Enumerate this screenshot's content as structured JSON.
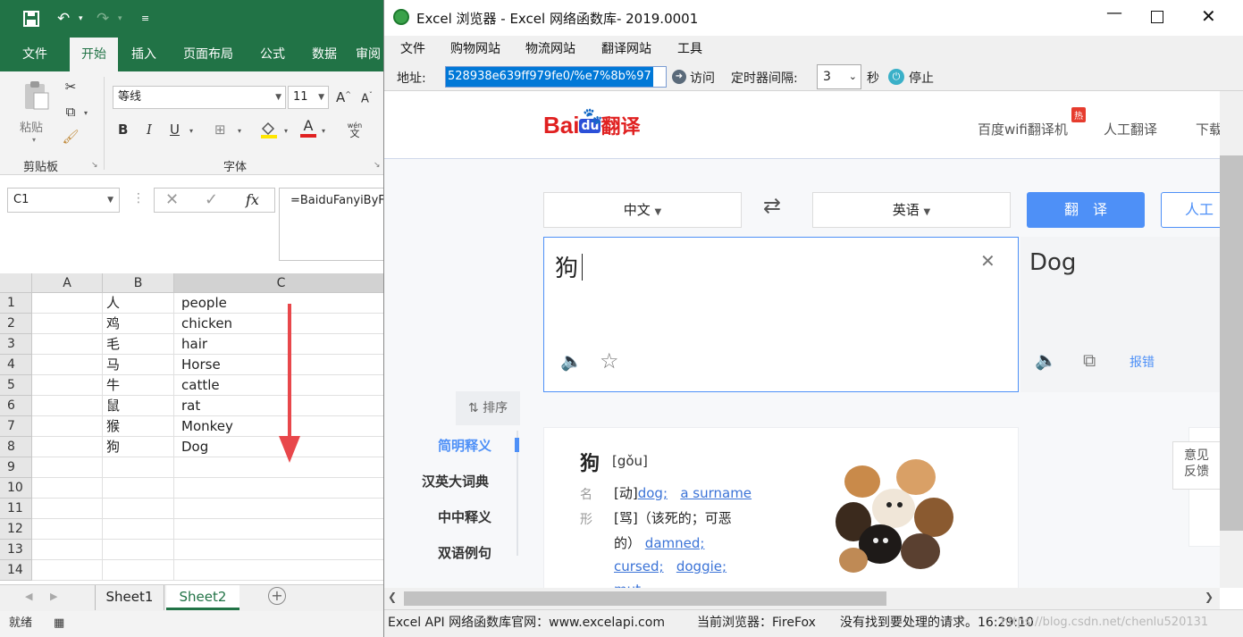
{
  "excel": {
    "qat": {
      "save_icon": "save-icon",
      "undo_icon": "undo-icon",
      "redo_icon": "redo-icon"
    },
    "tabs": [
      "文件",
      "开始",
      "插入",
      "页面布局",
      "公式",
      "数据",
      "审阅"
    ],
    "active_tab": "开始",
    "ribbon": {
      "paste_label": "粘贴",
      "clipboard_label": "剪贴板",
      "font_group_label": "字体",
      "font_name": "等线",
      "font_size": "11",
      "bold": "B",
      "italic": "I",
      "underline": "U",
      "grow_font": "A",
      "shrink_font": "A",
      "font_color": "A",
      "phonetic_top": "wén",
      "phonetic_bottom": "文"
    },
    "name_box": "C1",
    "fx": "fx",
    "formula": "=BaiduFanyiByF",
    "columns": [
      "A",
      "B",
      "C"
    ],
    "rows": [
      {
        "n": "1",
        "b": "人",
        "c": "people"
      },
      {
        "n": "2",
        "b": "鸡",
        "c": "chicken"
      },
      {
        "n": "3",
        "b": "毛",
        "c": "hair"
      },
      {
        "n": "4",
        "b": "马",
        "c": "Horse"
      },
      {
        "n": "5",
        "b": "牛",
        "c": "cattle"
      },
      {
        "n": "6",
        "b": "鼠",
        "c": "rat"
      },
      {
        "n": "7",
        "b": "猴",
        "c": "Monkey"
      },
      {
        "n": "8",
        "b": "狗",
        "c": "Dog"
      },
      {
        "n": "9",
        "b": "",
        "c": ""
      },
      {
        "n": "10",
        "b": "",
        "c": ""
      },
      {
        "n": "11",
        "b": "",
        "c": ""
      },
      {
        "n": "12",
        "b": "",
        "c": ""
      },
      {
        "n": "13",
        "b": "",
        "c": ""
      },
      {
        "n": "14",
        "b": "",
        "c": ""
      }
    ],
    "sheets": [
      "Sheet1",
      "Sheet2"
    ],
    "active_sheet": "Sheet2",
    "status": "就绪",
    "arrow_color": "#e8474b",
    "accent": "#217346"
  },
  "browser": {
    "title": "Excel 浏览器  - Excel 网络函数库- 2019.0001",
    "menu": [
      "文件",
      "购物网站",
      "物流网站",
      "翻译网站",
      "工具"
    ],
    "address_label": "地址:",
    "address_value": "528938e639ff979fe0/%e7%8b%97",
    "visit_label": "访问",
    "timer_label": "定时器间隔:",
    "timer_value": "3",
    "seconds_label": "秒",
    "stop_label": "停止",
    "status": {
      "site": "Excel API 网络函数库官网：www.excelapi.com",
      "browser": "当前浏览器：FireFox",
      "message": "没有找到要处理的请求。16:29:10",
      "watermark": "https://blog.csdn.net/chenlu520131"
    }
  },
  "baidu": {
    "logo_text": "Bai",
    "logo_du": "du",
    "logo_fanyi": "翻译",
    "nav": [
      "百度wifi翻译机",
      "人工翻译",
      "下载"
    ],
    "hot_badge": "热",
    "source_lang": "中文",
    "target_lang": "英语",
    "translate_button": "翻　译",
    "human_button": "人工",
    "input_text": "狗",
    "output_text": "Dog",
    "report_label": "报错",
    "sort_label": "排序",
    "sidebar": [
      "简明释义",
      "汉英大词典",
      "中中释义",
      "双语例句"
    ],
    "dict": {
      "word": "狗",
      "pinyin": "[gǒu]",
      "pos_1": "名",
      "pos_2": "形",
      "line1_prefix": "[动]",
      "line1_link1": "dog;",
      "line1_link2": "a surname",
      "line2": "[骂]（该死的；可恶",
      "line3_prefix": "的）",
      "line3_link": "damned;",
      "line4_link1": "cursed;",
      "line4_link2": "doggie;",
      "line5_link": "mut"
    },
    "feedback_1": "意见",
    "feedback_2": "反馈",
    "accent": "#4e90f7"
  }
}
